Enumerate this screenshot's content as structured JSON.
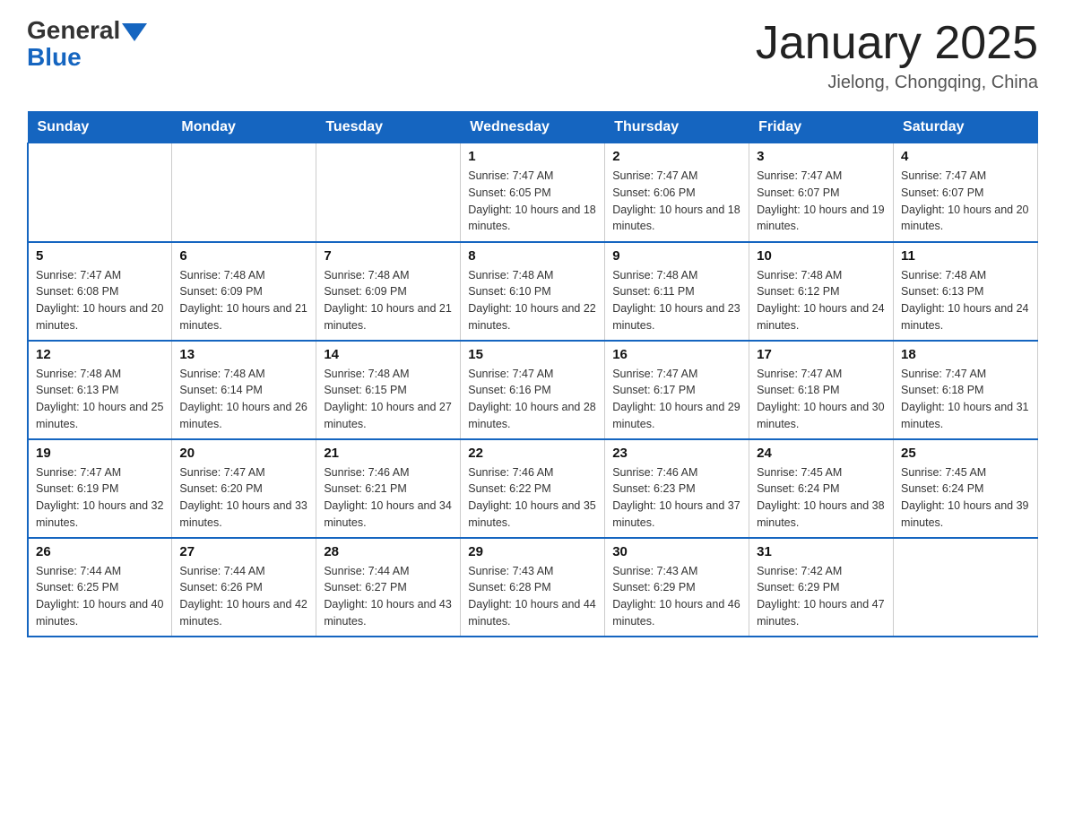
{
  "header": {
    "logo_general": "General",
    "logo_blue": "Blue",
    "title": "January 2025",
    "subtitle": "Jielong, Chongqing, China"
  },
  "weekdays": [
    "Sunday",
    "Monday",
    "Tuesday",
    "Wednesday",
    "Thursday",
    "Friday",
    "Saturday"
  ],
  "weeks": [
    [
      {
        "day": "",
        "sunrise": "",
        "sunset": "",
        "daylight": ""
      },
      {
        "day": "",
        "sunrise": "",
        "sunset": "",
        "daylight": ""
      },
      {
        "day": "",
        "sunrise": "",
        "sunset": "",
        "daylight": ""
      },
      {
        "day": "1",
        "sunrise": "Sunrise: 7:47 AM",
        "sunset": "Sunset: 6:05 PM",
        "daylight": "Daylight: 10 hours and 18 minutes."
      },
      {
        "day": "2",
        "sunrise": "Sunrise: 7:47 AM",
        "sunset": "Sunset: 6:06 PM",
        "daylight": "Daylight: 10 hours and 18 minutes."
      },
      {
        "day": "3",
        "sunrise": "Sunrise: 7:47 AM",
        "sunset": "Sunset: 6:07 PM",
        "daylight": "Daylight: 10 hours and 19 minutes."
      },
      {
        "day": "4",
        "sunrise": "Sunrise: 7:47 AM",
        "sunset": "Sunset: 6:07 PM",
        "daylight": "Daylight: 10 hours and 20 minutes."
      }
    ],
    [
      {
        "day": "5",
        "sunrise": "Sunrise: 7:47 AM",
        "sunset": "Sunset: 6:08 PM",
        "daylight": "Daylight: 10 hours and 20 minutes."
      },
      {
        "day": "6",
        "sunrise": "Sunrise: 7:48 AM",
        "sunset": "Sunset: 6:09 PM",
        "daylight": "Daylight: 10 hours and 21 minutes."
      },
      {
        "day": "7",
        "sunrise": "Sunrise: 7:48 AM",
        "sunset": "Sunset: 6:09 PM",
        "daylight": "Daylight: 10 hours and 21 minutes."
      },
      {
        "day": "8",
        "sunrise": "Sunrise: 7:48 AM",
        "sunset": "Sunset: 6:10 PM",
        "daylight": "Daylight: 10 hours and 22 minutes."
      },
      {
        "day": "9",
        "sunrise": "Sunrise: 7:48 AM",
        "sunset": "Sunset: 6:11 PM",
        "daylight": "Daylight: 10 hours and 23 minutes."
      },
      {
        "day": "10",
        "sunrise": "Sunrise: 7:48 AM",
        "sunset": "Sunset: 6:12 PM",
        "daylight": "Daylight: 10 hours and 24 minutes."
      },
      {
        "day": "11",
        "sunrise": "Sunrise: 7:48 AM",
        "sunset": "Sunset: 6:13 PM",
        "daylight": "Daylight: 10 hours and 24 minutes."
      }
    ],
    [
      {
        "day": "12",
        "sunrise": "Sunrise: 7:48 AM",
        "sunset": "Sunset: 6:13 PM",
        "daylight": "Daylight: 10 hours and 25 minutes."
      },
      {
        "day": "13",
        "sunrise": "Sunrise: 7:48 AM",
        "sunset": "Sunset: 6:14 PM",
        "daylight": "Daylight: 10 hours and 26 minutes."
      },
      {
        "day": "14",
        "sunrise": "Sunrise: 7:48 AM",
        "sunset": "Sunset: 6:15 PM",
        "daylight": "Daylight: 10 hours and 27 minutes."
      },
      {
        "day": "15",
        "sunrise": "Sunrise: 7:47 AM",
        "sunset": "Sunset: 6:16 PM",
        "daylight": "Daylight: 10 hours and 28 minutes."
      },
      {
        "day": "16",
        "sunrise": "Sunrise: 7:47 AM",
        "sunset": "Sunset: 6:17 PM",
        "daylight": "Daylight: 10 hours and 29 minutes."
      },
      {
        "day": "17",
        "sunrise": "Sunrise: 7:47 AM",
        "sunset": "Sunset: 6:18 PM",
        "daylight": "Daylight: 10 hours and 30 minutes."
      },
      {
        "day": "18",
        "sunrise": "Sunrise: 7:47 AM",
        "sunset": "Sunset: 6:18 PM",
        "daylight": "Daylight: 10 hours and 31 minutes."
      }
    ],
    [
      {
        "day": "19",
        "sunrise": "Sunrise: 7:47 AM",
        "sunset": "Sunset: 6:19 PM",
        "daylight": "Daylight: 10 hours and 32 minutes."
      },
      {
        "day": "20",
        "sunrise": "Sunrise: 7:47 AM",
        "sunset": "Sunset: 6:20 PM",
        "daylight": "Daylight: 10 hours and 33 minutes."
      },
      {
        "day": "21",
        "sunrise": "Sunrise: 7:46 AM",
        "sunset": "Sunset: 6:21 PM",
        "daylight": "Daylight: 10 hours and 34 minutes."
      },
      {
        "day": "22",
        "sunrise": "Sunrise: 7:46 AM",
        "sunset": "Sunset: 6:22 PM",
        "daylight": "Daylight: 10 hours and 35 minutes."
      },
      {
        "day": "23",
        "sunrise": "Sunrise: 7:46 AM",
        "sunset": "Sunset: 6:23 PM",
        "daylight": "Daylight: 10 hours and 37 minutes."
      },
      {
        "day": "24",
        "sunrise": "Sunrise: 7:45 AM",
        "sunset": "Sunset: 6:24 PM",
        "daylight": "Daylight: 10 hours and 38 minutes."
      },
      {
        "day": "25",
        "sunrise": "Sunrise: 7:45 AM",
        "sunset": "Sunset: 6:24 PM",
        "daylight": "Daylight: 10 hours and 39 minutes."
      }
    ],
    [
      {
        "day": "26",
        "sunrise": "Sunrise: 7:44 AM",
        "sunset": "Sunset: 6:25 PM",
        "daylight": "Daylight: 10 hours and 40 minutes."
      },
      {
        "day": "27",
        "sunrise": "Sunrise: 7:44 AM",
        "sunset": "Sunset: 6:26 PM",
        "daylight": "Daylight: 10 hours and 42 minutes."
      },
      {
        "day": "28",
        "sunrise": "Sunrise: 7:44 AM",
        "sunset": "Sunset: 6:27 PM",
        "daylight": "Daylight: 10 hours and 43 minutes."
      },
      {
        "day": "29",
        "sunrise": "Sunrise: 7:43 AM",
        "sunset": "Sunset: 6:28 PM",
        "daylight": "Daylight: 10 hours and 44 minutes."
      },
      {
        "day": "30",
        "sunrise": "Sunrise: 7:43 AM",
        "sunset": "Sunset: 6:29 PM",
        "daylight": "Daylight: 10 hours and 46 minutes."
      },
      {
        "day": "31",
        "sunrise": "Sunrise: 7:42 AM",
        "sunset": "Sunset: 6:29 PM",
        "daylight": "Daylight: 10 hours and 47 minutes."
      },
      {
        "day": "",
        "sunrise": "",
        "sunset": "",
        "daylight": ""
      }
    ]
  ]
}
